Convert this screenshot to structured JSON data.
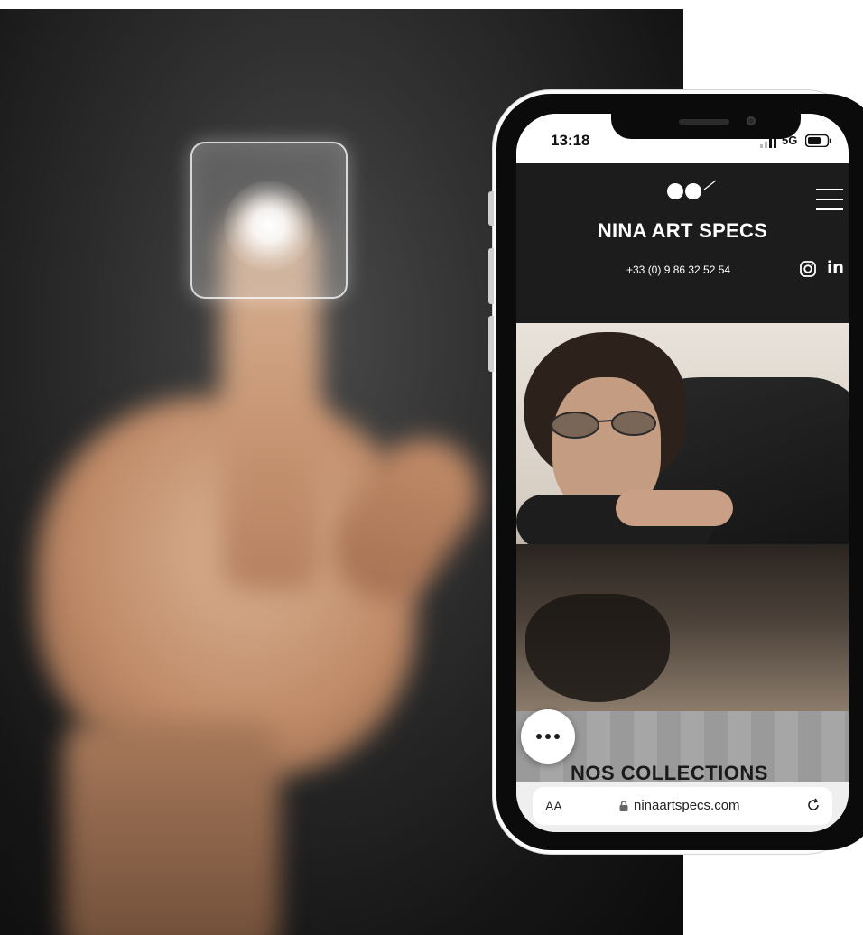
{
  "status_bar": {
    "time": "13:18",
    "network": "5G"
  },
  "site": {
    "brand_name": "NINA ART SPECS",
    "phone": "+33 (0) 9 86 32 52 54",
    "social": {
      "linkedin": "in"
    }
  },
  "sections": {
    "collections_title": "NOS COLLECTIONS"
  },
  "browser": {
    "text_size_label": "AA",
    "url": "ninaartspecs.com"
  },
  "icons": [
    "signal-icon",
    "battery-icon",
    "brand-logo-icon",
    "menu-icon",
    "instagram-icon",
    "linkedin-icon",
    "more-icon",
    "lock-icon",
    "reload-icon"
  ],
  "colors": {
    "header_bg": "#1c1c1c",
    "accent": "#ffffff"
  }
}
